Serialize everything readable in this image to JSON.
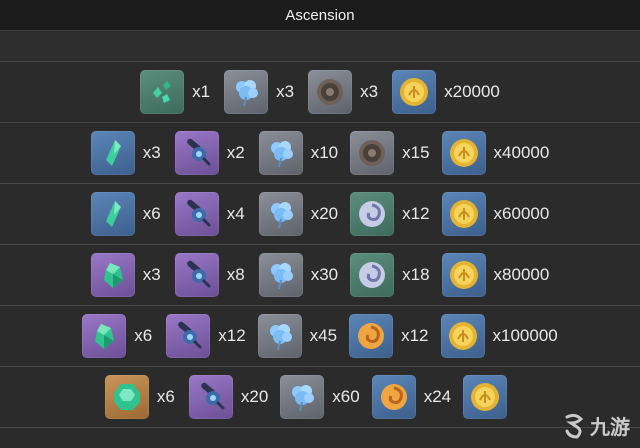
{
  "header": {
    "title": "Ascension"
  },
  "colors": {
    "background": "#2b2b2b",
    "header_bg": "#1c1c1c",
    "rarity_gray": "#7b7f88",
    "rarity_green": "#4e7f6e",
    "rarity_blue": "#4c73a3",
    "rarity_purple": "#8563b3",
    "rarity_gold": "#b88048"
  },
  "rows": [
    {
      "items": [
        {
          "icon": "green-gem-sliver-icon",
          "rarity": "green",
          "qty": "x1"
        },
        {
          "icon": "blue-flower-icon",
          "rarity": "gray",
          "qty": "x3"
        },
        {
          "icon": "gray-scroll-icon",
          "rarity": "gray",
          "qty": "x3"
        },
        {
          "icon": "mora-coin-icon",
          "rarity": "blue",
          "qty": "x20000"
        }
      ]
    },
    {
      "items": [
        {
          "icon": "green-gem-fragment-icon",
          "rarity": "blue",
          "qty": "x3"
        },
        {
          "icon": "boss-core-icon",
          "rarity": "purple",
          "qty": "x2"
        },
        {
          "icon": "blue-flower-icon",
          "rarity": "gray",
          "qty": "x10"
        },
        {
          "icon": "gray-scroll-icon",
          "rarity": "gray",
          "qty": "x15"
        },
        {
          "icon": "mora-coin-icon",
          "rarity": "blue",
          "qty": "x40000"
        }
      ]
    },
    {
      "items": [
        {
          "icon": "green-gem-fragment-icon",
          "rarity": "blue",
          "qty": "x6"
        },
        {
          "icon": "boss-core-icon",
          "rarity": "purple",
          "qty": "x4"
        },
        {
          "icon": "blue-flower-icon",
          "rarity": "gray",
          "qty": "x20"
        },
        {
          "icon": "silver-scroll-icon",
          "rarity": "green",
          "qty": "x12"
        },
        {
          "icon": "mora-coin-icon",
          "rarity": "blue",
          "qty": "x60000"
        }
      ]
    },
    {
      "items": [
        {
          "icon": "green-gem-chunk-icon",
          "rarity": "purple",
          "qty": "x3"
        },
        {
          "icon": "boss-core-icon",
          "rarity": "purple",
          "qty": "x8"
        },
        {
          "icon": "blue-flower-icon",
          "rarity": "gray",
          "qty": "x30"
        },
        {
          "icon": "silver-scroll-icon",
          "rarity": "green",
          "qty": "x18"
        },
        {
          "icon": "mora-coin-icon",
          "rarity": "blue",
          "qty": "x80000"
        }
      ]
    },
    {
      "items": [
        {
          "icon": "green-gem-chunk-icon",
          "rarity": "purple",
          "qty": "x6"
        },
        {
          "icon": "boss-core-icon",
          "rarity": "purple",
          "qty": "x12"
        },
        {
          "icon": "blue-flower-icon",
          "rarity": "gray",
          "qty": "x45"
        },
        {
          "icon": "gold-scroll-icon",
          "rarity": "blue",
          "qty": "x12"
        },
        {
          "icon": "mora-coin-icon",
          "rarity": "blue",
          "qty": "x100000"
        }
      ]
    },
    {
      "items": [
        {
          "icon": "green-gemstone-icon",
          "rarity": "gold",
          "qty": "x6"
        },
        {
          "icon": "boss-core-icon",
          "rarity": "purple",
          "qty": "x20"
        },
        {
          "icon": "blue-flower-icon",
          "rarity": "gray",
          "qty": "x60"
        },
        {
          "icon": "gold-scroll-icon",
          "rarity": "blue",
          "qty": "x24"
        },
        {
          "icon": "mora-coin-icon",
          "rarity": "blue",
          "qty": ""
        }
      ]
    }
  ],
  "watermark": {
    "text": "九游"
  }
}
